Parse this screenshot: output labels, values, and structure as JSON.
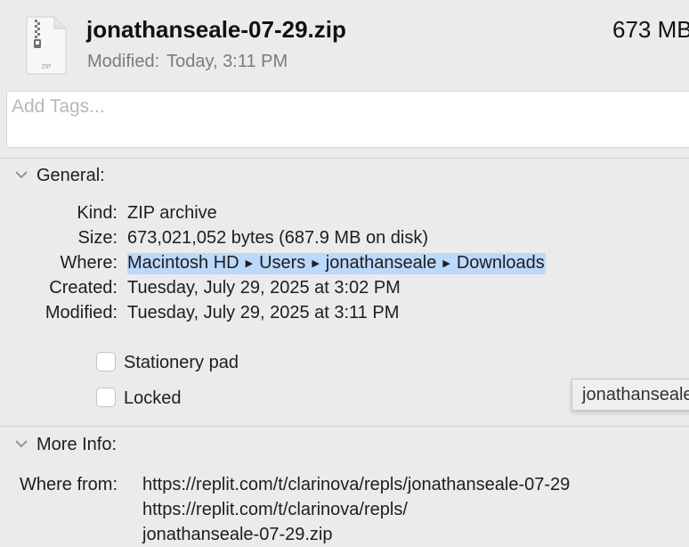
{
  "header": {
    "file_name": "jonathanseale-07-29.zip",
    "file_size": "673 MB",
    "icon_badge": "ZIP",
    "modified_label": "Modified:",
    "modified_value": "Today, 3:11 PM"
  },
  "tags": {
    "placeholder": "Add Tags..."
  },
  "general": {
    "heading": "General:",
    "kind_label": "Kind:",
    "kind_value": "ZIP archive",
    "size_label": "Size:",
    "size_value": "673,021,052 bytes (687.9 MB on disk)",
    "where_label": "Where:",
    "where_path": [
      "Macintosh HD",
      "Users",
      "jonathanseale",
      "Downloads"
    ],
    "created_label": "Created:",
    "created_value": "Tuesday, July 29, 2025 at 3:02 PM",
    "modified_label": "Modified:",
    "modified_value": "Tuesday, July 29, 2025 at 3:11 PM",
    "stationery_label": "Stationery pad",
    "stationery_checked": false,
    "locked_label": "Locked",
    "locked_checked": false
  },
  "tooltip": {
    "text": "jonathanseale"
  },
  "more_info": {
    "heading": "More Info:",
    "where_from_label": "Where from:",
    "where_from_lines": [
      "https://replit.com/t/clarinova/repls/jonathanseale-07-29",
      "https://replit.com/t/clarinova/repls/",
      "jonathanseale-07-29.zip"
    ]
  },
  "colors": {
    "background": "#ecebec",
    "selection_highlight": "#bcd8fb",
    "secondary_text": "#7b7b7b"
  }
}
